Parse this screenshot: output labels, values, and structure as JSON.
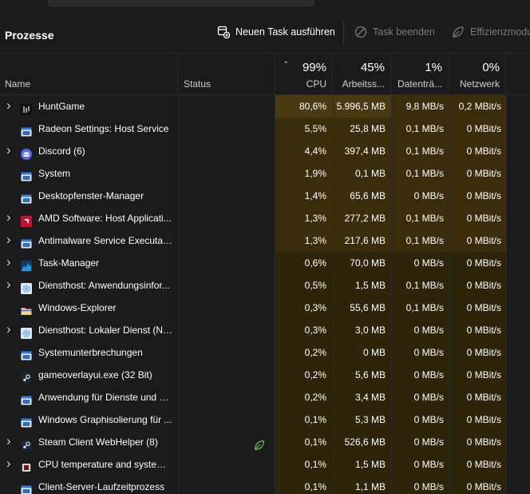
{
  "toolbar": {
    "title": "Prozesse",
    "new_task": "Neuen Task ausführen",
    "end_task": "Task beenden",
    "efficiency": "Effizienzmodus"
  },
  "columns": {
    "name": "Name",
    "status": "Status",
    "cpu_pct": "99%",
    "cpu": "CPU",
    "mem_pct": "45%",
    "mem": "Arbeitss...",
    "disk_pct": "1%",
    "disk": "Datenträ...",
    "net_pct": "0%",
    "net": "Netzwerk"
  },
  "rows": [
    {
      "name": "HuntGame",
      "expandable": true,
      "icon": "huntgame-icon",
      "icon_color": "#111111",
      "cpu": "80,6%",
      "mem": "5.996,5 MB",
      "disk": "9,8 MB/s",
      "net": "0,2 MBit/s",
      "leaf": false
    },
    {
      "name": "Radeon Settings: Host Service",
      "expandable": false,
      "icon": "window-app-icon",
      "icon_color": "#3a7bd5",
      "cpu": "5,5%",
      "mem": "25,8 MB",
      "disk": "0,1 MB/s",
      "net": "0 MBit/s",
      "leaf": false
    },
    {
      "name": "Discord (6)",
      "expandable": true,
      "icon": "discord-icon",
      "icon_color": "#5865f2",
      "cpu": "4,4%",
      "mem": "397,4 MB",
      "disk": "0,1 MB/s",
      "net": "0 MBit/s",
      "leaf": false
    },
    {
      "name": "System",
      "expandable": false,
      "icon": "window-app-icon",
      "icon_color": "#3a7bd5",
      "cpu": "1,9%",
      "mem": "0,1 MB",
      "disk": "0,1 MB/s",
      "net": "0 MBit/s",
      "leaf": false
    },
    {
      "name": "Desktopfenster-Manager",
      "expandable": false,
      "icon": "window-app-icon",
      "icon_color": "#3a7bd5",
      "cpu": "1,4%",
      "mem": "65,6 MB",
      "disk": "0 MB/s",
      "net": "0 MBit/s",
      "leaf": false
    },
    {
      "name": "AMD Software: Host Applicati...",
      "expandable": true,
      "icon": "amd-icon",
      "icon_color": "#c8102e",
      "cpu": "1,3%",
      "mem": "277,2 MB",
      "disk": "0,1 MB/s",
      "net": "0 MBit/s",
      "leaf": false
    },
    {
      "name": "Antimalware Service Executable",
      "expandable": true,
      "icon": "window-app-icon",
      "icon_color": "#3a7bd5",
      "cpu": "1,3%",
      "mem": "217,6 MB",
      "disk": "0,1 MB/s",
      "net": "0 MBit/s",
      "leaf": false
    },
    {
      "name": "Task-Manager",
      "expandable": true,
      "icon": "task-manager-icon",
      "icon_color": "#2f8fd8",
      "cpu": "0,6%",
      "mem": "70,0 MB",
      "disk": "0 MB/s",
      "net": "0 MBit/s",
      "leaf": false
    },
    {
      "name": "Diensthost: Anwendungsinfor...",
      "expandable": true,
      "icon": "gear-icon",
      "icon_color": "#6aa9e6",
      "cpu": "0,5%",
      "mem": "1,5 MB",
      "disk": "0,1 MB/s",
      "net": "0 MBit/s",
      "leaf": false
    },
    {
      "name": "Windows-Explorer",
      "expandable": false,
      "icon": "folder-icon",
      "icon_color": "#f2c14e",
      "cpu": "0,3%",
      "mem": "55,6 MB",
      "disk": "0,1 MB/s",
      "net": "0 MBit/s",
      "leaf": false
    },
    {
      "name": "Diensthost: Lokaler Dienst (Ne...",
      "expandable": true,
      "icon": "gear-icon",
      "icon_color": "#6aa9e6",
      "cpu": "0,3%",
      "mem": "3,0 MB",
      "disk": "0 MB/s",
      "net": "0 MBit/s",
      "leaf": false
    },
    {
      "name": "Systemunterbrechungen",
      "expandable": false,
      "icon": "window-app-icon",
      "icon_color": "#3a7bd5",
      "cpu": "0,2%",
      "mem": "0 MB",
      "disk": "0 MB/s",
      "net": "0 MBit/s",
      "leaf": false
    },
    {
      "name": "gameoverlayui.exe (32 Bit)",
      "expandable": false,
      "icon": "steam-icon",
      "icon_color": "#1b2838",
      "cpu": "0,2%",
      "mem": "5,6 MB",
      "disk": "0 MB/s",
      "net": "0 MBit/s",
      "leaf": false
    },
    {
      "name": "Anwendung für Dienste und C...",
      "expandable": false,
      "icon": "window-app-icon",
      "icon_color": "#3a7bd5",
      "cpu": "0,2%",
      "mem": "3,4 MB",
      "disk": "0 MB/s",
      "net": "0 MBit/s",
      "leaf": false
    },
    {
      "name": "Windows Graphisolierung für ...",
      "expandable": false,
      "icon": "window-app-icon",
      "icon_color": "#3a7bd5",
      "cpu": "0,1%",
      "mem": "5,3 MB",
      "disk": "0 MB/s",
      "net": "0 MBit/s",
      "leaf": false
    },
    {
      "name": "Steam Client WebHelper (8)",
      "expandable": true,
      "icon": "steam-icon",
      "icon_color": "#1b2838",
      "cpu": "0,1%",
      "mem": "526,6 MB",
      "disk": "0 MB/s",
      "net": "0 MBit/s",
      "leaf": true
    },
    {
      "name": "CPU temperature and system i...",
      "expandable": true,
      "icon": "cpu-temp-icon",
      "icon_color": "#d9d9d9",
      "cpu": "0,1%",
      "mem": "1,5 MB",
      "disk": "0 MB/s",
      "net": "0 MBit/s",
      "leaf": false
    },
    {
      "name": "Client-Server-Laufzeitprozess",
      "expandable": false,
      "icon": "window-app-icon",
      "icon_color": "#3a7bd5",
      "cpu": "0,1%",
      "mem": "1,1 MB",
      "disk": "0 MB/s",
      "net": "0 MBit/s",
      "leaf": false
    }
  ]
}
